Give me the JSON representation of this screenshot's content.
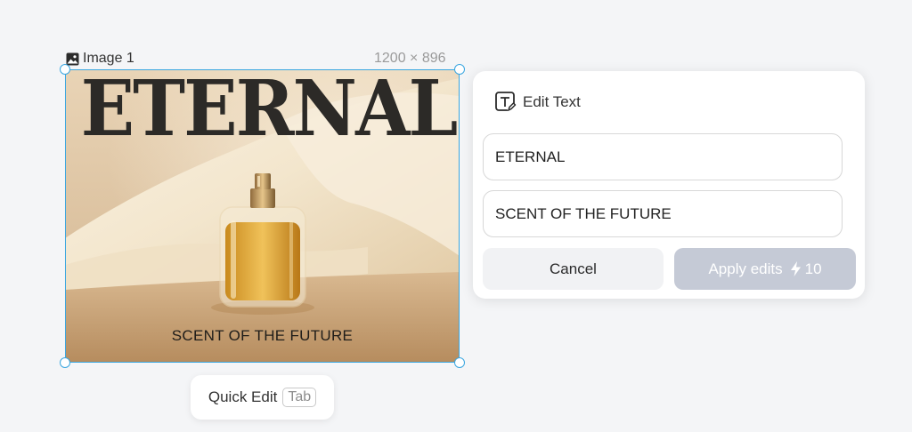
{
  "image": {
    "name": "Image 1",
    "dimensions": "1200 × 896",
    "headline": "ETERNAL",
    "subline": "SCENT OF THE FUTURE"
  },
  "quick_edit": {
    "label": "Quick Edit",
    "shortcut": "Tab"
  },
  "edit_panel": {
    "title": "Edit Text",
    "fields": [
      {
        "value": "ETERNAL"
      },
      {
        "value": "SCENT OF THE FUTURE"
      }
    ],
    "cancel_label": "Cancel",
    "apply_label": "Apply edits",
    "apply_cost": "10"
  },
  "colors": {
    "selection": "#3aa6e0",
    "apply_disabled": "#c5cad6",
    "background": "#f4f5f7"
  }
}
